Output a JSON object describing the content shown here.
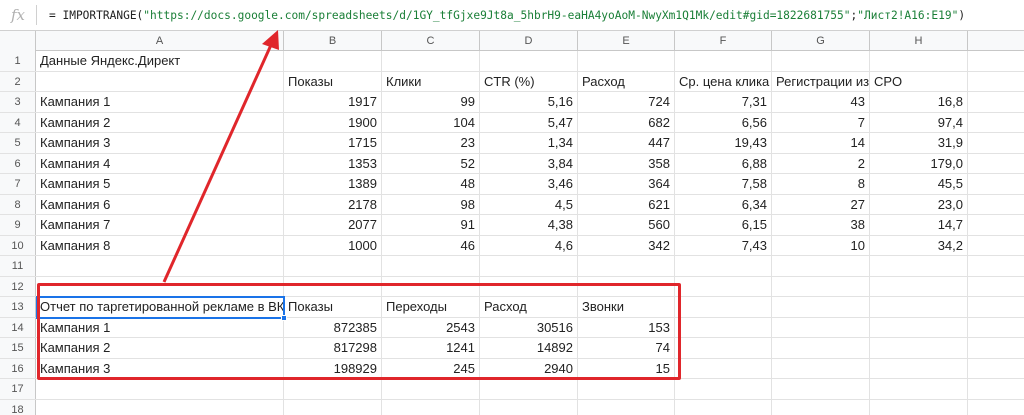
{
  "formula_bar": {
    "fx_label": "fx",
    "prefix": "= IMPORTRANGE(",
    "url": "\"https://docs.google.com/spreadsheets/d/1GY_tfGjxe9Jt8a_5hbrH9-eaHA4yoAoM-NwyXm1Q1Mk/edit#gid=1822681755\"",
    "sep": ";",
    "range": "\"Лист2!A16:E19\"",
    "suffix": ")"
  },
  "columns": [
    "A",
    "B",
    "C",
    "D",
    "E",
    "F",
    "G",
    "H"
  ],
  "rows": [
    {
      "n": "1",
      "cells": [
        "Данные Яндекс.Директ",
        "",
        "",
        "",
        "",
        "",
        "",
        ""
      ]
    },
    {
      "n": "2",
      "cells": [
        "",
        "Показы",
        "Клики",
        "CTR (%)",
        "Расход",
        "Ср. цена клика",
        "Регистрации из",
        "CPO"
      ]
    },
    {
      "n": "3",
      "cells": [
        "Кампания 1",
        "1917",
        "99",
        "5,16",
        "724",
        "7,31",
        "43",
        "16,8"
      ]
    },
    {
      "n": "4",
      "cells": [
        "Кампания 2",
        "1900",
        "104",
        "5,47",
        "682",
        "6,56",
        "7",
        "97,4"
      ]
    },
    {
      "n": "5",
      "cells": [
        "Кампания 3",
        "1715",
        "23",
        "1,34",
        "447",
        "19,43",
        "14",
        "31,9"
      ]
    },
    {
      "n": "6",
      "cells": [
        "Кампания 4",
        "1353",
        "52",
        "3,84",
        "358",
        "6,88",
        "2",
        "179,0"
      ]
    },
    {
      "n": "7",
      "cells": [
        "Кампания 5",
        "1389",
        "48",
        "3,46",
        "364",
        "7,58",
        "8",
        "45,5"
      ]
    },
    {
      "n": "8",
      "cells": [
        "Кампания 6",
        "2178",
        "98",
        "4,5",
        "621",
        "6,34",
        "27",
        "23,0"
      ]
    },
    {
      "n": "9",
      "cells": [
        "Кампания 7",
        "2077",
        "91",
        "4,38",
        "560",
        "6,15",
        "38",
        "14,7"
      ]
    },
    {
      "n": "10",
      "cells": [
        "Кампания 8",
        "1000",
        "46",
        "4,6",
        "342",
        "7,43",
        "10",
        "34,2"
      ]
    },
    {
      "n": "11",
      "cells": [
        "",
        "",
        "",
        "",
        "",
        "",
        "",
        ""
      ]
    },
    {
      "n": "12",
      "cells": [
        "",
        "",
        "",
        "",
        "",
        "",
        "",
        ""
      ]
    },
    {
      "n": "13",
      "cells": [
        "Отчет по таргетированной рекламе в ВК",
        "Показы",
        "Переходы",
        "Расход",
        "Звонки",
        "",
        "",
        ""
      ]
    },
    {
      "n": "14",
      "cells": [
        "Кампания 1",
        "872385",
        "2543",
        "30516",
        "153",
        "",
        "",
        ""
      ]
    },
    {
      "n": "15",
      "cells": [
        "Кампания 2",
        "817298",
        "1241",
        "14892",
        "74",
        "",
        "",
        ""
      ]
    },
    {
      "n": "16",
      "cells": [
        "Кампания 3",
        "198929",
        "245",
        "2940",
        "15",
        "",
        "",
        ""
      ]
    },
    {
      "n": "17",
      "cells": [
        "",
        "",
        "",
        "",
        "",
        "",
        "",
        ""
      ]
    },
    {
      "n": "18",
      "cells": [
        "",
        "",
        "",
        "",
        "",
        "",
        "",
        ""
      ]
    }
  ],
  "colors": {
    "annotation": "#e0262b",
    "selection": "#1a73e8"
  }
}
